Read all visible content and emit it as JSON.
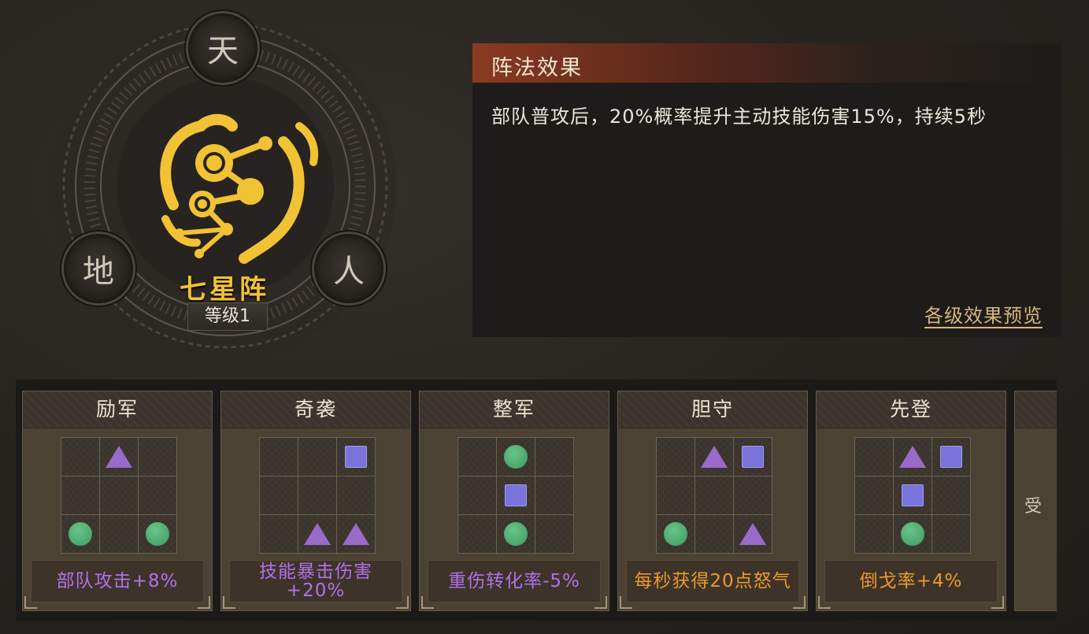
{
  "emblem": {
    "buttons": {
      "tian": "天",
      "di": "地",
      "ren": "人"
    },
    "name": "七星阵",
    "level": "等级1",
    "colors": {
      "gold": "#f2c235",
      "ring": "#5b554b"
    }
  },
  "effect_panel": {
    "title": "阵法效果",
    "description": "部队普攻后，20%概率提升主动技能伤害15%，持续5秒",
    "preview_link": "各级效果预览"
  },
  "bonus_cards": [
    {
      "name": "励军",
      "bonus": "部队攻击+8%",
      "color": "purple",
      "grid": [
        [
          "",
          "triangle",
          ""
        ],
        [
          "",
          "",
          ""
        ],
        [
          "circle",
          "",
          "circle"
        ]
      ]
    },
    {
      "name": "奇袭",
      "bonus": "技能暴击伤害+20%",
      "color": "purple",
      "grid": [
        [
          "",
          "",
          "square"
        ],
        [
          "",
          "",
          ""
        ],
        [
          "",
          "triangle",
          "triangle"
        ]
      ]
    },
    {
      "name": "整军",
      "bonus": "重伤转化率-5%",
      "color": "purple",
      "grid": [
        [
          "",
          "circle",
          ""
        ],
        [
          "",
          "square",
          ""
        ],
        [
          "",
          "circle",
          ""
        ]
      ]
    },
    {
      "name": "胆守",
      "bonus": "每秒获得20点怒气",
      "color": "orange",
      "grid": [
        [
          "",
          "triangle",
          "square"
        ],
        [
          "",
          "",
          ""
        ],
        [
          "circle",
          "",
          "triangle"
        ]
      ]
    },
    {
      "name": "先登",
      "bonus": "倒戈率+4%",
      "color": "orange",
      "grid": [
        [
          "",
          "triangle",
          "square"
        ],
        [
          "",
          "square",
          ""
        ],
        [
          "",
          "circle",
          ""
        ]
      ]
    }
  ],
  "partial_card": {
    "text": "受"
  },
  "colors": {
    "purple_text": "#b072e8",
    "orange_text": "#ec9a2d",
    "triangle": "#9a6ac9",
    "square": "#7a73dc",
    "circle": "#4fae72"
  }
}
